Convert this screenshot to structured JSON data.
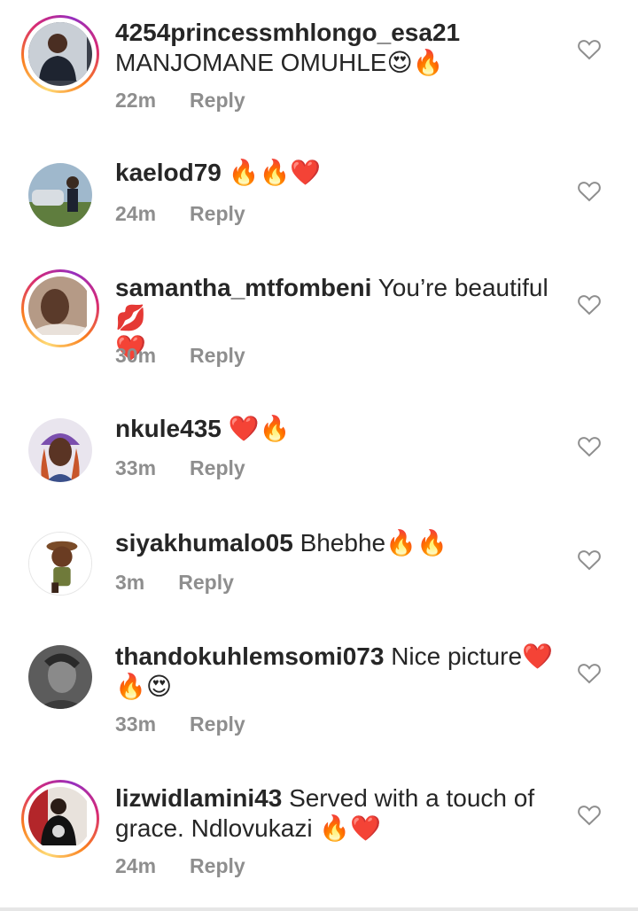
{
  "comments": [
    {
      "username": "4254princessmhlongo_esa21",
      "line1": "",
      "line2": "MANJOMANE OMUHLE",
      "emoji": "😍🔥",
      "time": "22m",
      "reply": "Reply",
      "avatar_color": "#3a3f4a",
      "story": true
    },
    {
      "username": "kaelod79",
      "line1": "",
      "emoji": "🔥🔥❤️",
      "time": "24m",
      "reply": "Reply",
      "avatar_color": "#6d8aa3",
      "story": false
    },
    {
      "username": "samantha_mtfombeni",
      "line1": "You’re beautiful 💋",
      "line2": "",
      "emoji": "❤️",
      "time": "30m",
      "reply": "Reply",
      "avatar_color": "#7a5a44",
      "story": true
    },
    {
      "username": "nkule435",
      "line1": "",
      "emoji": "❤️🔥",
      "time": "33m",
      "reply": "Reply",
      "avatar_color": "#c0455f",
      "story": false
    },
    {
      "username": "siyakhumalo05",
      "line1": "Bhebhe",
      "emoji": "🔥🔥",
      "time": "3m",
      "reply": "Reply",
      "avatar_color": "#8c6b3a",
      "story": false
    },
    {
      "username": "thandokuhlemsomi073",
      "line1": "Nice picture",
      "emoji_inline": "❤️",
      "emoji": "🔥😍",
      "time": "33m",
      "reply": "Reply",
      "avatar_color": "#6c6c6c",
      "story": false
    },
    {
      "username": "lizwidlamini43",
      "line1": "Served with a touch of",
      "line2": "grace. Ndlovukazi",
      "emoji": "🔥❤️",
      "time": "24m",
      "reply": "Reply",
      "avatar_color": "#7a1f22",
      "story": true
    }
  ]
}
